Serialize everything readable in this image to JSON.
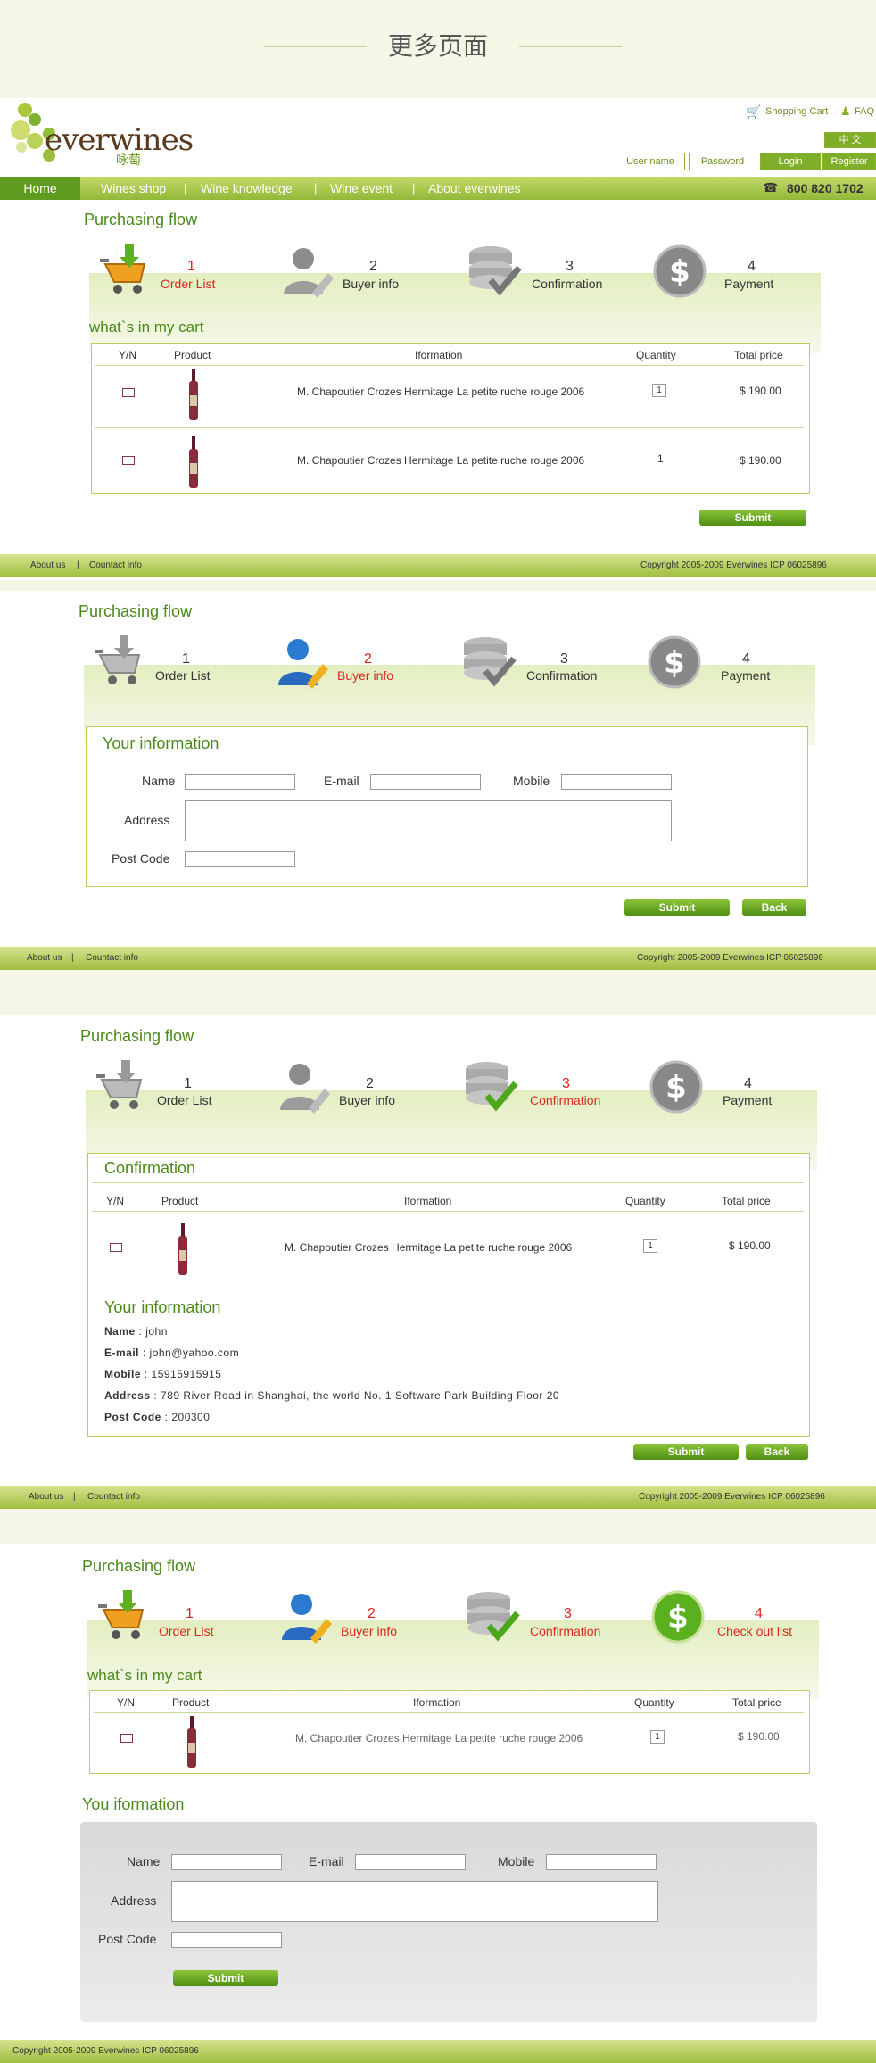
{
  "page": {
    "title": "更多页面"
  },
  "header": {
    "brand": "everwines",
    "brand_cn": "咏萄",
    "shopping_cart": "Shopping Cart",
    "faq": "FAQ",
    "lang": "中 文",
    "username": "User name",
    "password": "Password",
    "login": "Login",
    "register": "Register",
    "phone": "800  820  1702"
  },
  "nav": {
    "home": "Home",
    "items": [
      "Wines shop",
      "Wine knowledge",
      "Wine event",
      "About everwines"
    ]
  },
  "flow": {
    "title": "Purchasing flow",
    "steps": [
      {
        "num": "1",
        "label": "Order List"
      },
      {
        "num": "2",
        "label": "Buyer info"
      },
      {
        "num": "3",
        "label": "Confirmation"
      },
      {
        "num": "4",
        "label": "Payment"
      }
    ],
    "step4_alt": "Check out list"
  },
  "cart": {
    "title": "what`s in my cart",
    "columns": [
      "Y/N",
      "Product",
      "Iformation",
      "Quantity",
      "Total price"
    ],
    "rows": [
      {
        "info": "M. Chapoutier Crozes Hermitage La petite ruche rouge 2006",
        "qty": "1",
        "price": "$ 190.00"
      },
      {
        "info": "M. Chapoutier Crozes Hermitage La petite ruche rouge 2006",
        "qty": "1",
        "price": "$ 190.00"
      }
    ]
  },
  "buttons": {
    "submit": "Submit",
    "back": "Back"
  },
  "form": {
    "title": "Your information",
    "title_alt": "You iformation",
    "name": "Name",
    "email": "E-mail",
    "mobile": "Mobile",
    "address": "Address",
    "postcode": "Post Code"
  },
  "confirmation": {
    "title": "Confirmation",
    "info_title": "Your information",
    "name_k": "Name",
    "name_v": "john",
    "email_k": "E-mail",
    "email_v": "john@yahoo.com",
    "mobile_k": "Mobile",
    "mobile_v": "15915915915",
    "address_k": "Address",
    "address_v": "789 River Road in Shanghai, the world No. 1 Software Park Building Floor 20",
    "post_k": "Post Code",
    "post_v": "200300"
  },
  "footer": {
    "about": "About us",
    "sep": "|",
    "contact": "Countact info",
    "copyright": "Copyright  2005-2009 Everwines  ICP 06025896"
  },
  "colors": {
    "green": "#4a8a1a",
    "red": "#d8281d",
    "band": "#e3eec0"
  }
}
